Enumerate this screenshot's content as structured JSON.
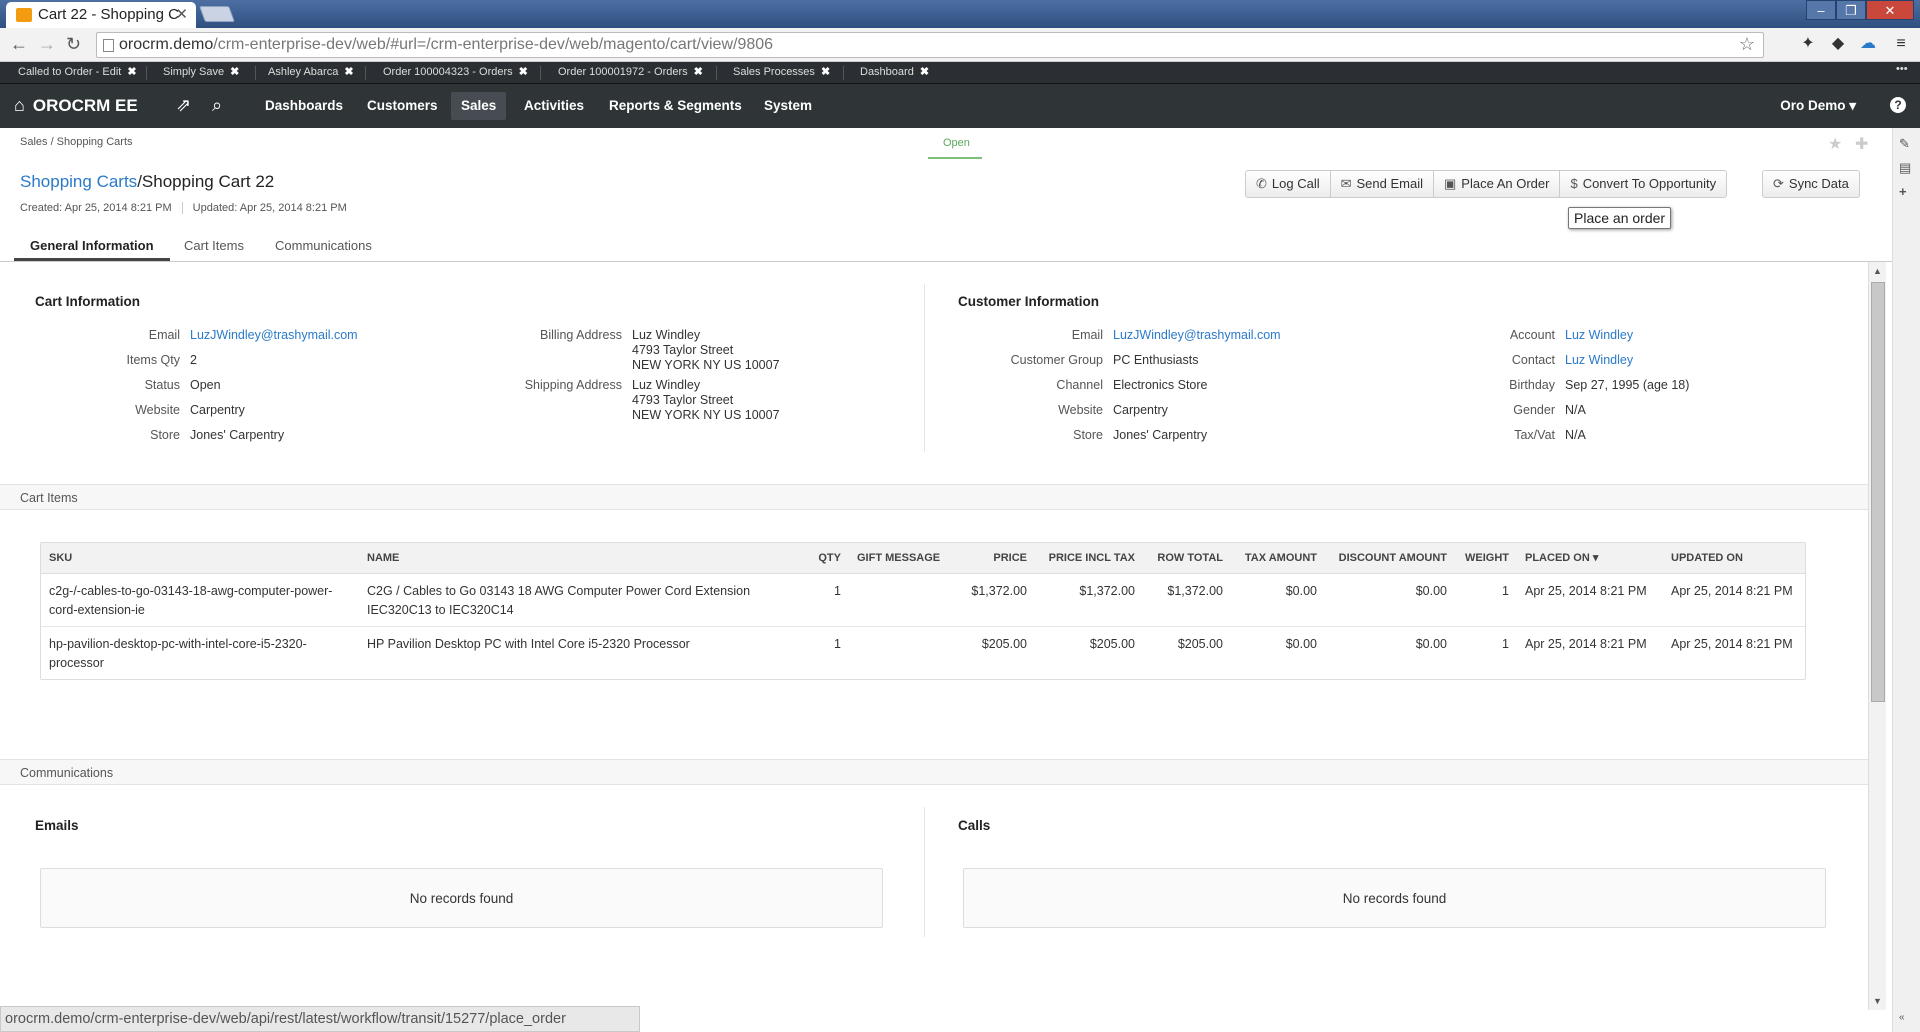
{
  "browser": {
    "tab_title": "Cart 22 - Shopping C",
    "url_host": "orocrm.demo",
    "url_path": "/crm-enterprise-dev/web/#url=/crm-enterprise-dev/web/magento/cart/view/9806",
    "status_url": "orocrm.demo/crm-enterprise-dev/web/api/rest/latest/workflow/transit/15277/place_order"
  },
  "pinned_tabs": [
    "Called to Order - Edit",
    "Simply Save",
    "Ashley Abarca",
    "Order 100004323 - Orders",
    "Order 100001972 - Orders",
    "Sales Processes",
    "Dashboard"
  ],
  "nav": {
    "logo": "OROCRM EE",
    "menus": [
      "Dashboards",
      "Customers",
      "Sales",
      "Activities",
      "Reports & Segments",
      "System"
    ],
    "active_menu": "Sales",
    "user": "Oro Demo"
  },
  "breadcrumb": "Sales / Shopping Carts",
  "workflow_status": "Open",
  "page": {
    "parent_link": "Shopping Carts",
    "separator": "/",
    "title": "Shopping Cart 22",
    "created": "Created: Apr 25, 2014 8:21 PM",
    "updated": "Updated: Apr 25, 2014 8:21 PM"
  },
  "actions": {
    "log_call": "Log Call",
    "send_email": "Send Email",
    "place_order": "Place An Order",
    "convert": "Convert To Opportunity",
    "sync": "Sync Data",
    "tooltip": "Place an order"
  },
  "tabs": [
    "General Information",
    "Cart Items",
    "Communications"
  ],
  "cart_info": {
    "heading": "Cart Information",
    "email_label": "Email",
    "email": "LuzJWindley@trashymail.com",
    "qty_label": "Items Qty",
    "qty": "2",
    "status_label": "Status",
    "status": "Open",
    "website_label": "Website",
    "website": "Carpentry",
    "store_label": "Store",
    "store": "Jones' Carpentry",
    "billing_label": "Billing Address",
    "billing": [
      "Luz Windley",
      "4793 Taylor Street",
      "NEW YORK NY US 10007"
    ],
    "shipping_label": "Shipping Address",
    "shipping": [
      "Luz Windley",
      "4793 Taylor Street",
      "NEW YORK NY US 10007"
    ]
  },
  "customer_info": {
    "heading": "Customer Information",
    "email_label": "Email",
    "email": "LuzJWindley@trashymail.com",
    "group_label": "Customer Group",
    "group": "PC Enthusiasts",
    "channel_label": "Channel",
    "channel": "Electronics Store",
    "website_label": "Website",
    "website": "Carpentry",
    "store_label": "Store",
    "store": "Jones' Carpentry",
    "account_label": "Account",
    "account": "Luz Windley",
    "contact_label": "Contact",
    "contact": "Luz Windley",
    "birthday_label": "Birthday",
    "birthday": "Sep 27, 1995 (age 18)",
    "gender_label": "Gender",
    "gender": "N/A",
    "taxvat_label": "Tax/Vat",
    "taxvat": "N/A"
  },
  "cart_items": {
    "section_title": "Cart Items",
    "columns": [
      "SKU",
      "NAME",
      "QTY",
      "GIFT MESSAGE",
      "PRICE",
      "PRICE INCL TAX",
      "ROW TOTAL",
      "TAX AMOUNT",
      "DISCOUNT AMOUNT",
      "WEIGHT",
      "PLACED ON",
      "UPDATED ON"
    ],
    "rows": [
      {
        "sku": "c2g-/-cables-to-go-03143-18-awg-computer-power-cord-extension-ie",
        "name": "C2G / Cables to Go 03143 18 AWG Computer Power Cord Extension IEC320C13 to IEC320C14",
        "qty": "1",
        "gift": "",
        "price": "$1,372.00",
        "price_incl": "$1,372.00",
        "row_total": "$1,372.00",
        "tax": "$0.00",
        "discount": "$0.00",
        "weight": "1",
        "placed": "Apr 25, 2014 8:21 PM",
        "updated": "Apr 25, 2014 8:21 PM"
      },
      {
        "sku": "hp-pavilion-desktop-pc-with-intel-core-i5-2320-processor",
        "name": "HP Pavilion Desktop PC with Intel Core i5-2320 Processor",
        "qty": "1",
        "gift": "",
        "price": "$205.00",
        "price_incl": "$205.00",
        "row_total": "$205.00",
        "tax": "$0.00",
        "discount": "$0.00",
        "weight": "1",
        "placed": "Apr 25, 2014 8:21 PM",
        "updated": "Apr 25, 2014 8:21 PM"
      }
    ]
  },
  "communications": {
    "section_title": "Communications",
    "emails_heading": "Emails",
    "calls_heading": "Calls",
    "empty": "No records found"
  }
}
